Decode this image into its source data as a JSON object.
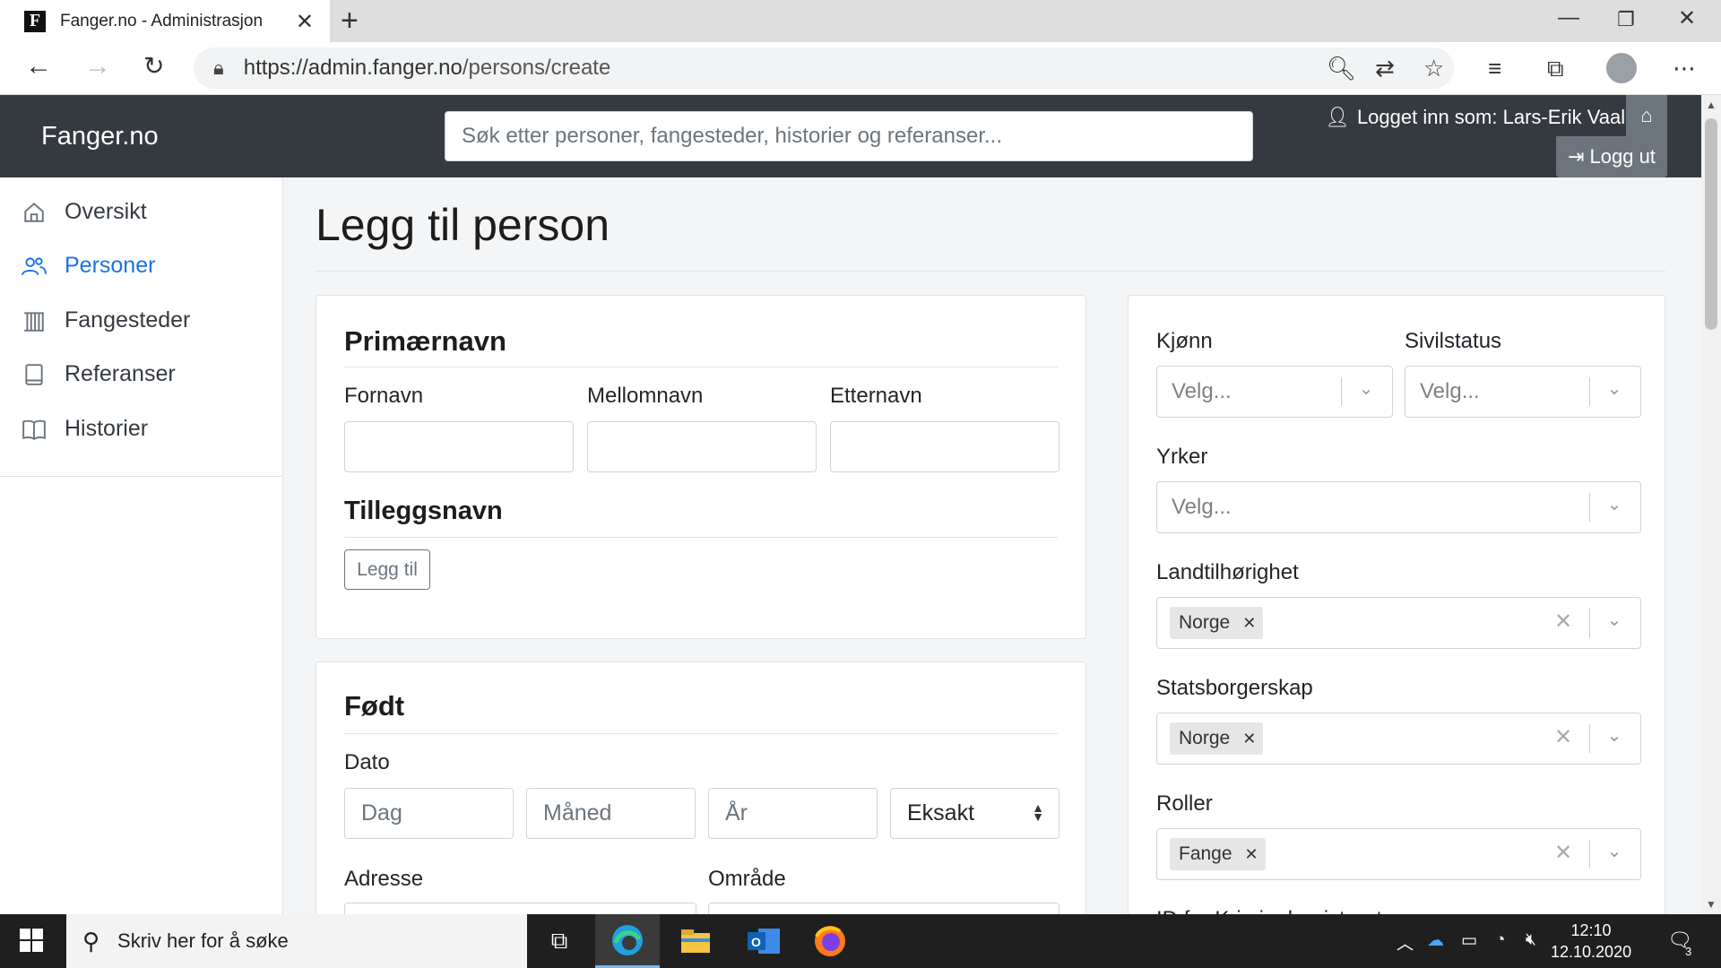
{
  "browser": {
    "tab_title": "Fanger.no - Administrasjon",
    "favicon_letter": "F",
    "url_host": "https://admin.fanger.no",
    "url_path": "/persons/create"
  },
  "header": {
    "brand": "Fanger.no",
    "search_placeholder": "Søk etter personer, fangesteder, historier og referanser...",
    "logged_in": "Logget inn som: Lars-Erik Vaale",
    "logout": "Logg ut"
  },
  "sidebar": {
    "items": [
      {
        "label": "Oversikt",
        "icon": "home-icon"
      },
      {
        "label": "Personer",
        "icon": "people-icon",
        "active": true
      },
      {
        "label": "Fangesteder",
        "icon": "prison-icon"
      },
      {
        "label": "Referanser",
        "icon": "book-icon"
      },
      {
        "label": "Historier",
        "icon": "open-book-icon"
      }
    ]
  },
  "main": {
    "title": "Legg til person",
    "primary_name": {
      "heading": "Primærnavn",
      "first": "Fornavn",
      "middle": "Mellomnavn",
      "last": "Etternavn"
    },
    "extra_names": {
      "heading": "Tilleggsnavn",
      "add_button": "Legg til"
    },
    "born": {
      "heading": "Født",
      "date_label": "Dato",
      "day_placeholder": "Dag",
      "month_placeholder": "Måned",
      "year_placeholder": "År",
      "precision": "Eksakt",
      "address_label": "Adresse",
      "area_label": "Område"
    },
    "right": {
      "gender_label": "Kjønn",
      "civil_label": "Sivilstatus",
      "select_placeholder": "Velg...",
      "occupation_label": "Yrker",
      "country_label": "Landtilhørighet",
      "country_value": "Norge",
      "citizenship_label": "Statsborgerskap",
      "citizenship_value": "Norge",
      "roles_label": "Roller",
      "roles_value": "Fange",
      "cutoff_label": "ID fra Kriminalregisteret"
    }
  },
  "taskbar": {
    "search_placeholder": "Skriv her for å søke",
    "time": "12:10",
    "date": "12.10.2020",
    "notifications": "3"
  },
  "colors": {
    "header_bg": "#343a40",
    "active_link": "#1a73e8",
    "secondary": "#6c757d"
  }
}
